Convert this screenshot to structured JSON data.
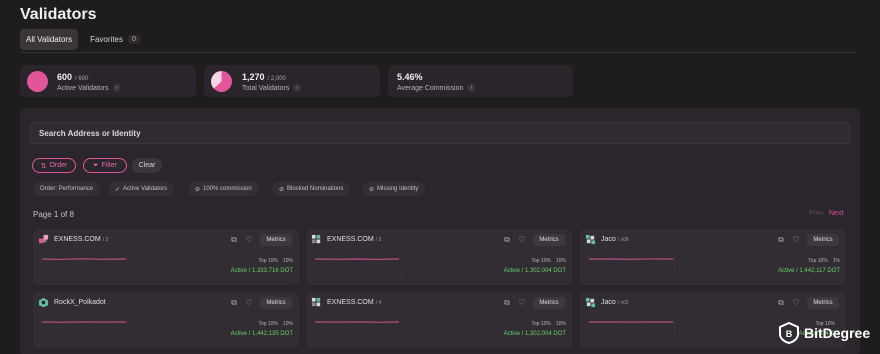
{
  "header": {
    "title": "Validators"
  },
  "tabs": [
    {
      "label": "All Validators"
    },
    {
      "label": "Favorites",
      "count": "0"
    }
  ],
  "stats": [
    {
      "value": "600",
      "total": "/ 600",
      "label": "Active Validators"
    },
    {
      "value": "1,270",
      "total": "/ 2,000",
      "label": "Total Validators"
    },
    {
      "value": "5.46%",
      "label": "Average Commission"
    }
  ],
  "search": {
    "placeholder": "Search Address or Identity"
  },
  "controls": {
    "order": "Order",
    "filter": "Filter",
    "clear": "Clear"
  },
  "filters": [
    {
      "label": "Order: Performance"
    },
    {
      "label": "Active Validators"
    },
    {
      "label": "100% commission"
    },
    {
      "label": "Blocked Nominations"
    },
    {
      "label": "Missing Identity"
    }
  ],
  "pagination": {
    "text": "Page 1 of 8",
    "prev": "Prev",
    "next": "Next"
  },
  "validators": [
    {
      "name": "EXNESS.COM",
      "sub": "/ 3",
      "top": "Top 10%",
      "commission": "10%",
      "status": "Active / 1,333,716 DOT"
    },
    {
      "name": "EXNESS.COM",
      "sub": "/ 5",
      "top": "Top 10%",
      "commission": "10%",
      "status": "Active / 1,302,004 DOT"
    },
    {
      "name": "Jaco",
      "sub": "/ v08",
      "top": "Top 10%",
      "commission": "1%",
      "status": "Active / 1,442,117 DOT"
    },
    {
      "name": "RockX_Polkadot",
      "sub": "",
      "top": "Top 10%",
      "commission": "10%",
      "status": "Active / 1,442,135 DOT"
    },
    {
      "name": "EXNESS.COM",
      "sub": "/ 4",
      "top": "Top 10%",
      "commission": "10%",
      "status": "Active / 1,302,004 DOT"
    },
    {
      "name": "Jaco",
      "sub": "/ v02",
      "top": "Top 10%",
      "commission": "",
      "status": "Active / 1,442,1"
    }
  ],
  "card_labels": {
    "metrics": "Metrics"
  },
  "watermark": {
    "text": "BitDegree"
  },
  "colors": {
    "accent": "#e2559a",
    "active": "#6ad16a",
    "background": "#1f1c1e"
  }
}
